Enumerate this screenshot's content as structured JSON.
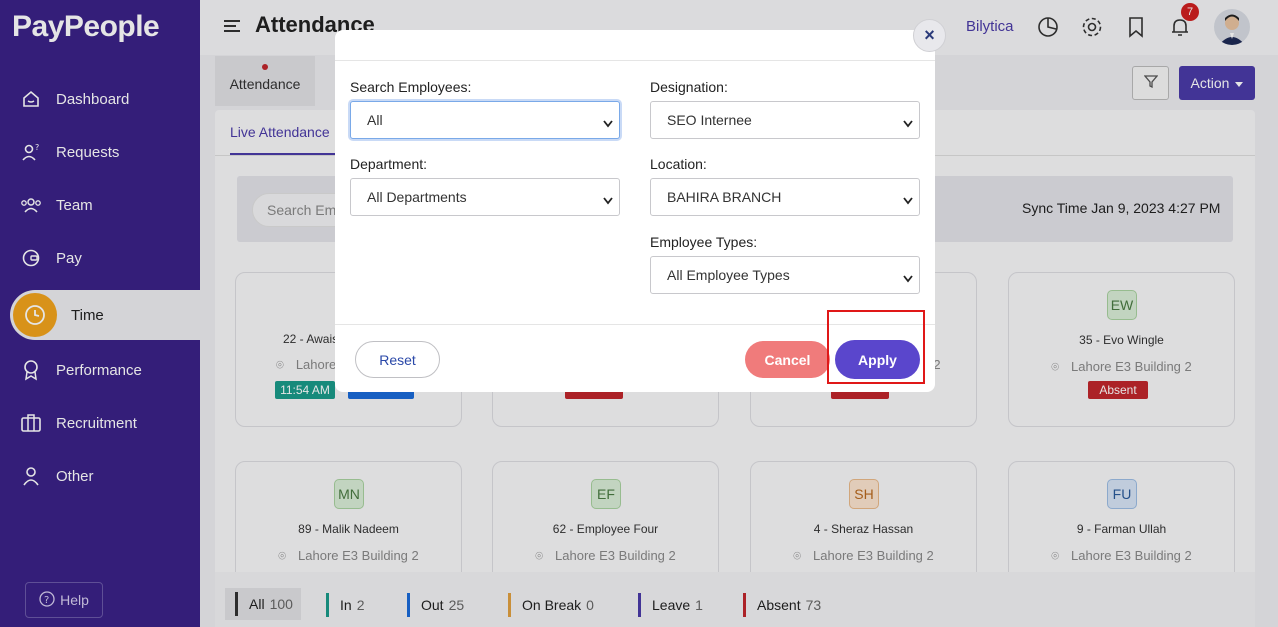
{
  "brand": "PayPeople",
  "sidebar": {
    "items": [
      {
        "label": "Dashboard",
        "icon": "dashboard-icon"
      },
      {
        "label": "Requests",
        "icon": "requests-icon"
      },
      {
        "label": "Team",
        "icon": "team-icon"
      },
      {
        "label": "Pay",
        "icon": "pay-icon"
      },
      {
        "label": "Time",
        "icon": "clock-icon",
        "active": true
      },
      {
        "label": "Performance",
        "icon": "award-icon"
      },
      {
        "label": "Recruitment",
        "icon": "briefcase-icon"
      },
      {
        "label": "Other",
        "icon": "user-icon"
      }
    ],
    "help": "Help"
  },
  "header": {
    "title": "Attendance",
    "company": "Bilytica",
    "notifications": "7"
  },
  "toolbar": {
    "tab": "Attendance",
    "action": "Action"
  },
  "panel": {
    "subtab": "Live Attendance",
    "search_placeholder": "Search Em",
    "sync": "Sync Time Jan 9, 2023 4:27 PM"
  },
  "cards": [
    {
      "initials": "",
      "name": "22 - Awais",
      "location": "Lahore",
      "tags": [
        "11:54 AM",
        ""
      ]
    },
    {
      "initials": "EW",
      "name": "35 - Evo Wingle",
      "location": "Lahore E3 Building 2",
      "tags": [
        "Absent"
      ]
    },
    {
      "initials": "MN",
      "name": "89 - Malik Nadeem",
      "location": "Lahore E3 Building 2"
    },
    {
      "initials": "EF",
      "name": "62 - Employee Four",
      "location": "Lahore E3 Building 2"
    },
    {
      "initials": "SH",
      "name": "4 - Sheraz Hassan",
      "location": "Lahore E3 Building 2"
    },
    {
      "initials": "FU",
      "name": "9 - Farman Ullah",
      "location": "Lahore E3 Building 2"
    },
    {
      "location_partial_2": "2",
      "location_partial_3": "2"
    }
  ],
  "status": [
    {
      "label": "All",
      "count": "100",
      "color": "#333333"
    },
    {
      "label": "In",
      "count": "2",
      "color": "#1a9a8a"
    },
    {
      "label": "Out",
      "count": "25",
      "color": "#1a6ad8"
    },
    {
      "label": "On Break",
      "count": "0",
      "color": "#e0a040"
    },
    {
      "label": "Leave",
      "count": "1",
      "color": "#4a3aa8"
    },
    {
      "label": "Absent",
      "count": "73",
      "color": "#c0262c"
    }
  ],
  "modal": {
    "search_employees_label": "Search Employees:",
    "search_employees_value": "All",
    "designation_label": "Designation:",
    "designation_value": "SEO Internee",
    "department_label": "Department:",
    "department_value": "All Departments",
    "location_label": "Location:",
    "location_value": "BAHIRA BRANCH",
    "employee_types_label": "Employee Types:",
    "employee_types_value": "All Employee Types",
    "reset": "Reset",
    "cancel": "Cancel",
    "apply": "Apply",
    "close": "×"
  },
  "colors": {
    "sidebar": "#3a2287",
    "primary": "#4a3aa8",
    "apply": "#5a46cc",
    "cancel": "#f07b7b",
    "highlight": "#e01818"
  }
}
